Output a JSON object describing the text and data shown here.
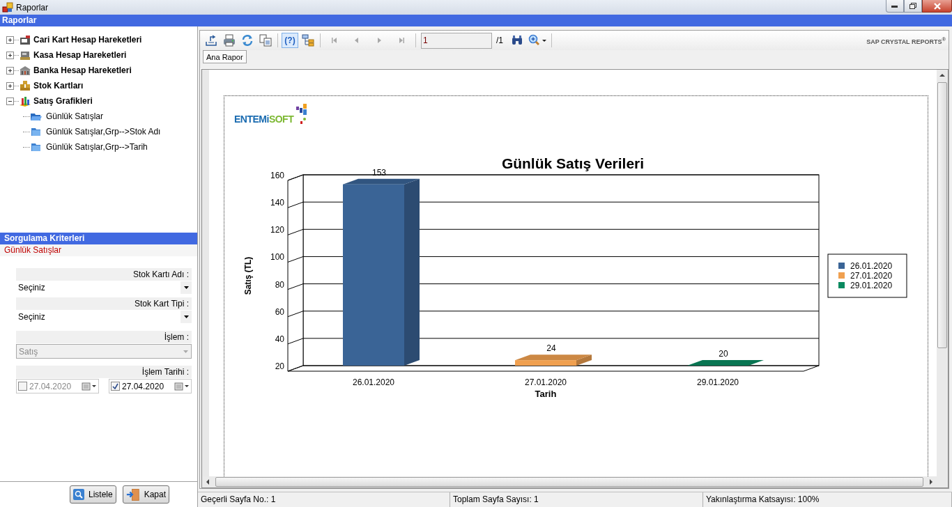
{
  "window": {
    "title": "Raporlar"
  },
  "header": "Raporlar",
  "tree": [
    {
      "label": "Cari Kart Hesap Hareketleri",
      "expanded": false
    },
    {
      "label": "Kasa Hesap Hareketleri",
      "expanded": false
    },
    {
      "label": "Banka Hesap Hareketleri",
      "expanded": false
    },
    {
      "label": "Stok Kartları",
      "expanded": false
    },
    {
      "label": "Satış Grafikleri",
      "expanded": true,
      "children": [
        {
          "label": "Günlük Satışlar"
        },
        {
          "label": "Günlük Satışlar,Grp-->Stok Adı"
        },
        {
          "label": "Günlük Satışlar,Grp-->Tarih"
        }
      ]
    }
  ],
  "criteria": {
    "title": "Sorgulama Kriterleri",
    "subtitle": "Günlük Satışlar",
    "fields": [
      {
        "kind": "combo",
        "label": "Stok Kartı Adı :",
        "value": "Seçiniz",
        "disabled": false
      },
      {
        "kind": "combo",
        "label": "Stok Kart Tipi :",
        "value": "Seçiniz",
        "disabled": false
      },
      {
        "kind": "combo",
        "label": "İşlem :",
        "value": "Satış",
        "disabled": true
      },
      {
        "kind": "dates",
        "label": "İşlem Tarihi :",
        "dates": [
          {
            "value": "27.04.2020",
            "checked": false
          },
          {
            "value": "27.04.2020",
            "checked": true
          }
        ]
      }
    ]
  },
  "buttons": [
    {
      "label": "Listele"
    },
    {
      "label": "Kapat"
    }
  ],
  "toolbar": {
    "help": "(?)",
    "help_pressed": true,
    "nav_disabled": true,
    "page_value": "1",
    "page_total": "/1",
    "brand": "SAP CRYSTAL REPORTS$^{®}$"
  },
  "tabs": [
    {
      "label": "Ana Rapor",
      "selected": true
    }
  ],
  "report": {
    "logo": {
      "part_1": "ENTEMi",
      "part_2": "SOFT"
    },
    "chart_data": {
      "type": "bar",
      "title": "Günlük Satış Verileri",
      "xlabel": "Tarih",
      "ylabel": "Satış (TL)",
      "categories": [
        "26.01.2020",
        "27.01.2020",
        "29.01.2020"
      ],
      "series": [
        {
          "name": "26.01.2020",
          "color": "#3a6496",
          "values": [
            153,
            null,
            null
          ]
        },
        {
          "name": "27.01.2020",
          "color": "#f0a050",
          "values": [
            null,
            24,
            null
          ]
        },
        {
          "name": "29.01.2020",
          "color": "#0a8a60",
          "values": [
            null,
            null,
            20
          ]
        }
      ],
      "legend": "right",
      "ylim": [
        20,
        160
      ],
      "yticks": [
        20,
        40,
        60,
        80,
        100,
        120,
        140,
        160
      ],
      "data_labels": true
    }
  },
  "status_bar": [
    "Geçerli Sayfa No.: 1",
    "Toplam Sayfa Sayısı: 1",
    "Yakınlaştırma Katsayısı: 100%"
  ]
}
